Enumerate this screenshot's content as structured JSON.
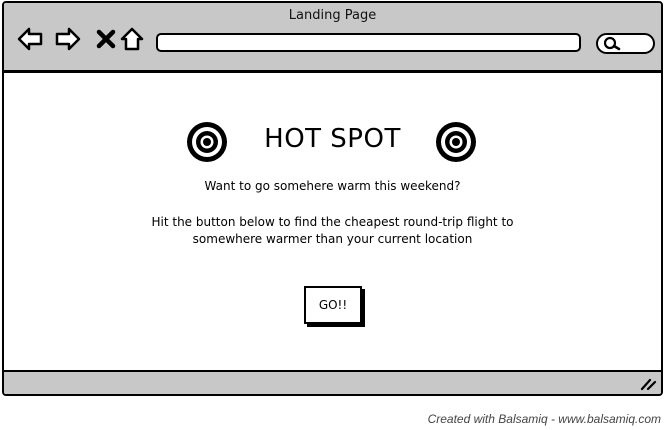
{
  "window": {
    "title": "Landing Page"
  },
  "toolbar": {
    "icons": [
      "back-arrow-icon",
      "forward-arrow-icon",
      "close-icon",
      "home-icon",
      "search-icon"
    ],
    "url_value": "",
    "search_value": ""
  },
  "main": {
    "headline": "HOT SPOT",
    "tagline": "Want to go somehere warm this weekend?",
    "description_line1": "Hit the button below to find the cheapest round-trip flight to",
    "description_line2": "somewhere warmer than your current location",
    "go_button_label": "GO!!"
  },
  "footer": {
    "credit": "Created with Balsamiq - www.balsamiq.com"
  },
  "colors": {
    "chrome_gray": "#c8c8c8",
    "ink": "#000000"
  }
}
